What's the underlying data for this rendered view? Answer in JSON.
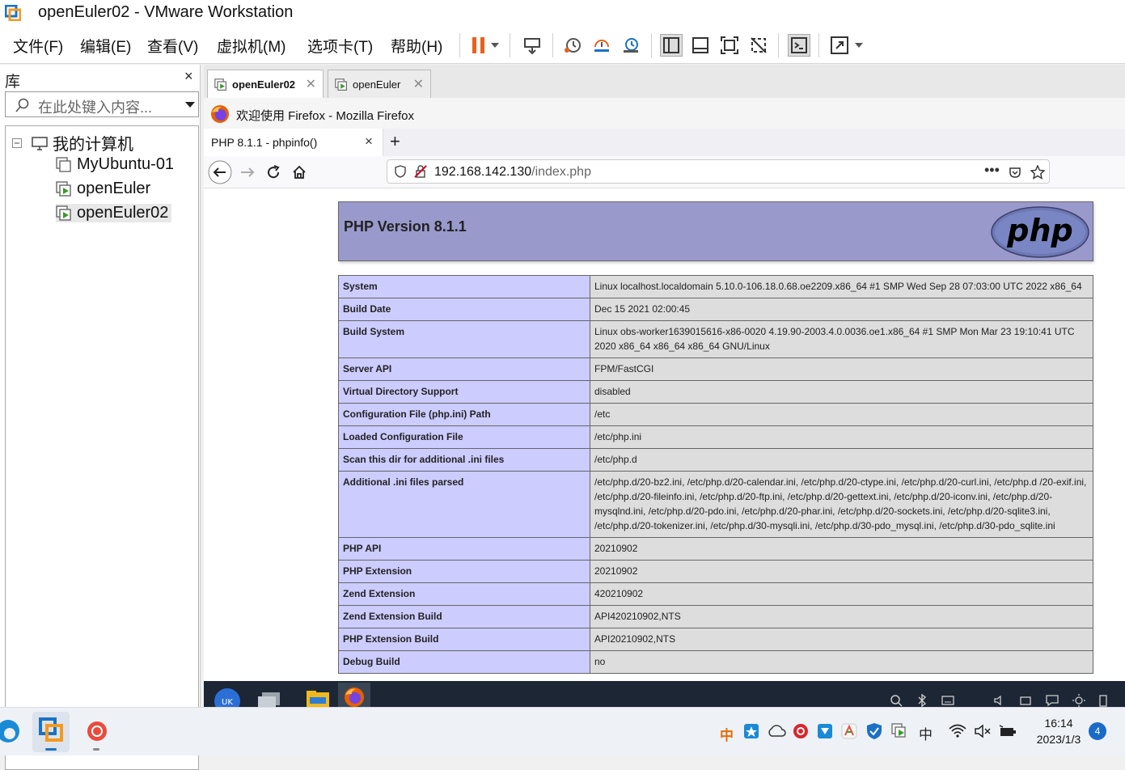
{
  "window": {
    "title": "openEuler02 - VMware Workstation"
  },
  "menu": {
    "items": [
      "文件(F)",
      "编辑(E)",
      "查看(V)",
      "虚拟机(M)",
      "选项卡(T)",
      "帮助(H)"
    ]
  },
  "library": {
    "title": "库",
    "close": "×",
    "search_placeholder": "在此处键入内容...",
    "tree_root": "我的计算机",
    "vms": [
      "MyUbuntu-01",
      "openEuler",
      "openEuler02"
    ],
    "selected": "openEuler02"
  },
  "vm_tabs": [
    {
      "label": "openEuler02",
      "active": true
    },
    {
      "label": "openEuler",
      "active": false
    }
  ],
  "firefox": {
    "window_title": "欢迎使用 Firefox - Mozilla Firefox",
    "tab_title": "PHP 8.1.1 - phpinfo()",
    "url_host": "192.168.142.130",
    "url_path": "/index.php",
    "new_tab": "+",
    "tab_close": "×"
  },
  "phpinfo": {
    "version_title": "PHP Version 8.1.1",
    "logo_text": "php",
    "rows": [
      {
        "name": "System",
        "value": "Linux localhost.localdomain 5.10.0-106.18.0.68.oe2209.x86_64 #1 SMP Wed Sep 28 07:03:00 UTC 2022 x86_64"
      },
      {
        "name": "Build Date",
        "value": "Dec 15 2021 02:00:45"
      },
      {
        "name": "Build System",
        "value": "Linux obs-worker1639015616-x86-0020 4.19.90-2003.4.0.0036.oe1.x86_64 #1 SMP Mon Mar 23 19:10:41 UTC 2020 x86_64 x86_64 x86_64 GNU/Linux"
      },
      {
        "name": "Server API",
        "value": "FPM/FastCGI"
      },
      {
        "name": "Virtual Directory Support",
        "value": "disabled"
      },
      {
        "name": "Configuration File (php.ini) Path",
        "value": "/etc"
      },
      {
        "name": "Loaded Configuration File",
        "value": "/etc/php.ini"
      },
      {
        "name": "Scan this dir for additional .ini files",
        "value": "/etc/php.d"
      },
      {
        "name": "Additional .ini files parsed",
        "value": "/etc/php.d/20-bz2.ini, /etc/php.d/20-calendar.ini, /etc/php.d/20-ctype.ini, /etc/php.d/20-curl.ini, /etc/php.d /20-exif.ini, /etc/php.d/20-fileinfo.ini, /etc/php.d/20-ftp.ini, /etc/php.d/20-gettext.ini, /etc/php.d/20-iconv.ini, /etc/php.d/20-mysqlnd.ini, /etc/php.d/20-pdo.ini, /etc/php.d/20-phar.ini, /etc/php.d/20-sockets.ini, /etc/php.d/20-sqlite3.ini, /etc/php.d/20-tokenizer.ini, /etc/php.d/30-mysqli.ini, /etc/php.d/30-pdo_mysql.ini, /etc/php.d/30-pdo_sqlite.ini"
      },
      {
        "name": "PHP API",
        "value": "20210902"
      },
      {
        "name": "PHP Extension",
        "value": "20210902"
      },
      {
        "name": "Zend Extension",
        "value": "420210902"
      },
      {
        "name": "Zend Extension Build",
        "value": "API420210902,NTS"
      },
      {
        "name": "PHP Extension Build",
        "value": "API20210902,NTS"
      },
      {
        "name": "Debug Build",
        "value": "no"
      }
    ]
  },
  "taskbar": {
    "time": "16:14",
    "date": "2023/1/3",
    "ime": "中",
    "ime2": "中",
    "notifications": "4"
  },
  "colors": {
    "php_header": "#9999cc",
    "php_key": "#ccccff",
    "php_value": "#dddddd",
    "guest_taskbar": "#1c2634",
    "pause_orange": "#e8611a"
  }
}
